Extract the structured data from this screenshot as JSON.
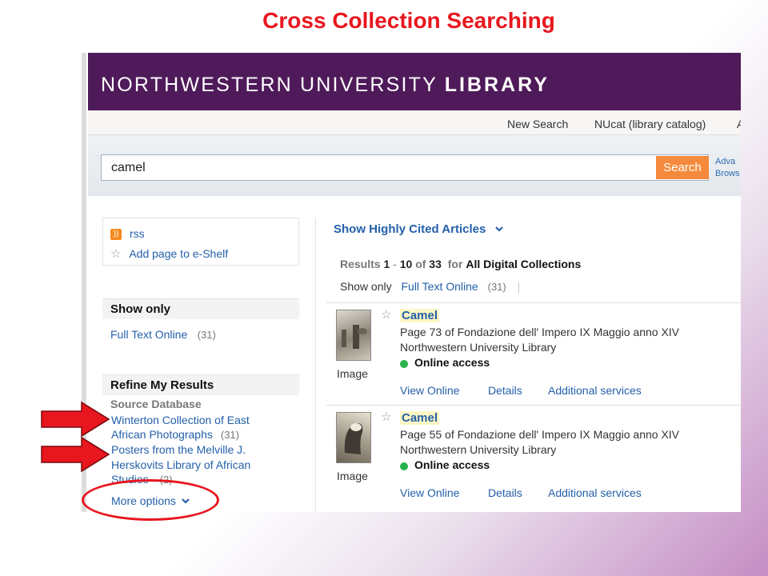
{
  "slide": {
    "title": "Cross Collection Searching"
  },
  "banner": {
    "logo_light": "NORTHWESTERN UNIVERSITY ",
    "logo_bold": "LIBRARY"
  },
  "navbar": {
    "new_search": "New Search",
    "nucat": "NUcat (library catalog)",
    "trailing": "A"
  },
  "search": {
    "value": "camel",
    "button": "Search",
    "advanced": "Adva",
    "browse": "Brows"
  },
  "sidebar": {
    "rss": "rss",
    "eshelf": "Add page to e-Shelf",
    "show_only_heading": "Show only",
    "full_text": "Full Text Online",
    "full_text_count": "(31)",
    "refine_heading": "Refine My Results",
    "source_db_label": "Source Database",
    "sources": [
      {
        "line1": "Winterton Collection of East",
        "line2": "African Photographs",
        "count": "(31)"
      },
      {
        "line1": "Posters from the Melville J.",
        "line2": "Herskovits Library of African",
        "line3": "Studies",
        "count": "(2)"
      }
    ],
    "more_options": "More options"
  },
  "results_header": {
    "highly_cited": "Show Highly Cited Articles",
    "results_word": "Results",
    "from": "1",
    "dash": "-",
    "to": "10",
    "of_word": "of",
    "total": "33",
    "for_word": "for",
    "collection": "All Digital Collections",
    "show_only": "Show only",
    "full_text": "Full Text Online",
    "full_text_count": "(31)"
  },
  "results": [
    {
      "title": "Camel",
      "line1": "Page 73 of Fondazione dell' Impero IX Maggio anno XIV",
      "line2": "Northwestern University Library",
      "access": "Online access",
      "type": "Image",
      "actions": [
        "View Online",
        "Details",
        "Additional services"
      ]
    },
    {
      "title": "Camel",
      "line1": "Page 55 of Fondazione dell' Impero IX Maggio anno XIV",
      "line2": "Northwestern University Library",
      "access": "Online access",
      "type": "Image",
      "actions": [
        "View Online",
        "Details",
        "Additional services"
      ]
    }
  ],
  "colors": {
    "title_red": "#e8161e",
    "banner_purple": "#4f1a5a",
    "search_orange": "#f58a3c",
    "link_blue": "#2460aa"
  }
}
